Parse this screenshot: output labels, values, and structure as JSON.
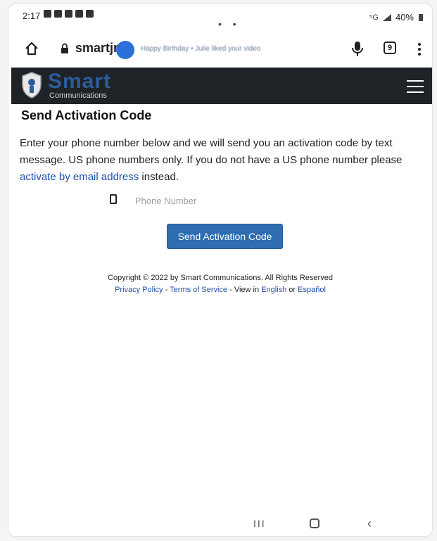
{
  "status_bar": {
    "time": "2:17",
    "center": "• •",
    "signal": "⁵G",
    "battery": "40%"
  },
  "browser": {
    "url": "smartjr",
    "notification_text": "Happy Birthday • Julie liked your video",
    "tab_count": "9"
  },
  "site_header": {
    "logo_title": "Smart",
    "logo_subtitle": "Communications"
  },
  "content": {
    "title": "Send Activation Code",
    "instructions_before": "Enter your phone number below and we will send you an activation code by text message. US phone numbers only. If you do not have a US phone number please ",
    "instructions_link": "activate by email address",
    "instructions_after": " instead.",
    "phone_placeholder": "Phone Number",
    "send_button": "Send Activation Code"
  },
  "footer": {
    "copyright": "Copyright © 2022 by Smart Communications. All Rights Reserved",
    "privacy": "Privacy Policy",
    "sep1": " - ",
    "terms": "Terms of Service",
    "view_in": " - View in ",
    "english": "English",
    "or": " or ",
    "espanol": "Español"
  },
  "nav": {
    "recents": "III",
    "back": "‹"
  }
}
